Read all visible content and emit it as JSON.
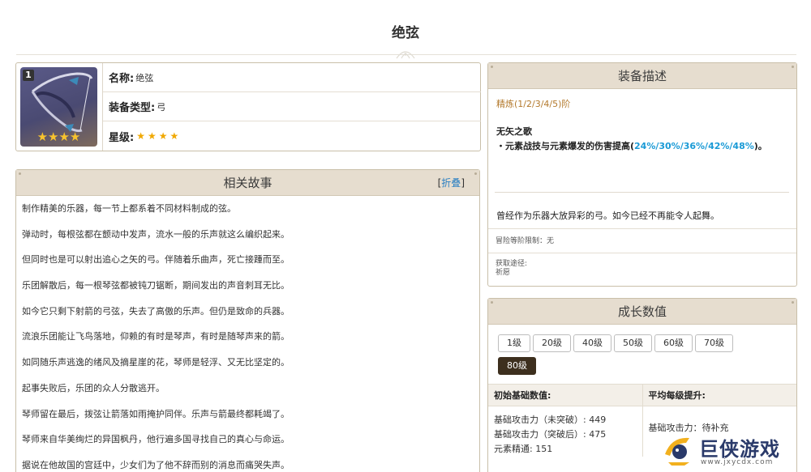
{
  "page": {
    "title": "绝弦"
  },
  "info": {
    "rank_badge": "1",
    "image_stars": "★★★★",
    "name_label": "名称:",
    "name_value": "绝弦",
    "type_label": "装备类型:",
    "type_value": "弓",
    "rarity_label": "星级:",
    "rarity_stars": "★★★★",
    "rarity_count": 4
  },
  "story": {
    "header": "相关故事",
    "fold_open": "[",
    "fold_link": "折叠",
    "fold_close": "]",
    "lines": [
      "制作精美的乐器，每一节上都系着不同材料制成的弦。",
      "弹动时，每根弦都在颤动中发声，流水一般的乐声就这么编织起来。",
      "但同时也是可以射出追心之矢的弓。伴随着乐曲声，死亡接踵而至。",
      "乐团解散后，每一根琴弦都被钝刀锯断，期间发出的声音刺耳无比。",
      "如今它只剩下射箭的弓弦，失去了高傲的乐声。但仍是致命的兵器。",
      "流浪乐团能让飞鸟落地，仰赖的有时是琴声，有时是随琴声来的箭。",
      "如同随乐声逃逸的绪风及摘星崖的花，琴师是轻浮、又无比坚定的。",
      "起事失败后，乐团的众人分散逃开。",
      "琴师留在最后，拨弦让箭落如雨掩护同伴。乐声与箭最终都耗竭了。",
      "琴师来自华美绚烂的异国枫丹，他行遍多国寻找自己的真心与命运。",
      "据说在他故国的宫廷中，少女们为了他不辞而别的消息而痛哭失声。"
    ]
  },
  "desc": {
    "header": "装备描述",
    "refine": "精炼(1/2/3/4/5)阶",
    "passive_name": "无矢之歌",
    "passive_prefix": "・元素战技与元素爆发的伤害提高(",
    "passive_values": "24%/30%/36%/42%/48%",
    "passive_suffix": ")。",
    "flavor": "曾经作为乐器大放异彩的弓。如今已经不再能令人起舞。",
    "adventure_rank": "冒险等阶限制：无",
    "obtain_label": "获取途径:",
    "obtain_value": "祈愿"
  },
  "growth": {
    "header": "成长数值",
    "levels": [
      "1级",
      "20级",
      "40级",
      "50级",
      "60级",
      "70级",
      "80级"
    ],
    "active_level": "80级",
    "col1_header": "初始基础数值:",
    "col2_header": "平均每级提升:",
    "base_stats": [
      "基础攻击力（未突破）: 449",
      "基础攻击力（突破后）: 475",
      "元素精通: 151"
    ],
    "per_level": "基础攻击力：待补充"
  },
  "watermark": {
    "brand": "巨侠游戏",
    "url": "www.jxycdx.com"
  }
}
